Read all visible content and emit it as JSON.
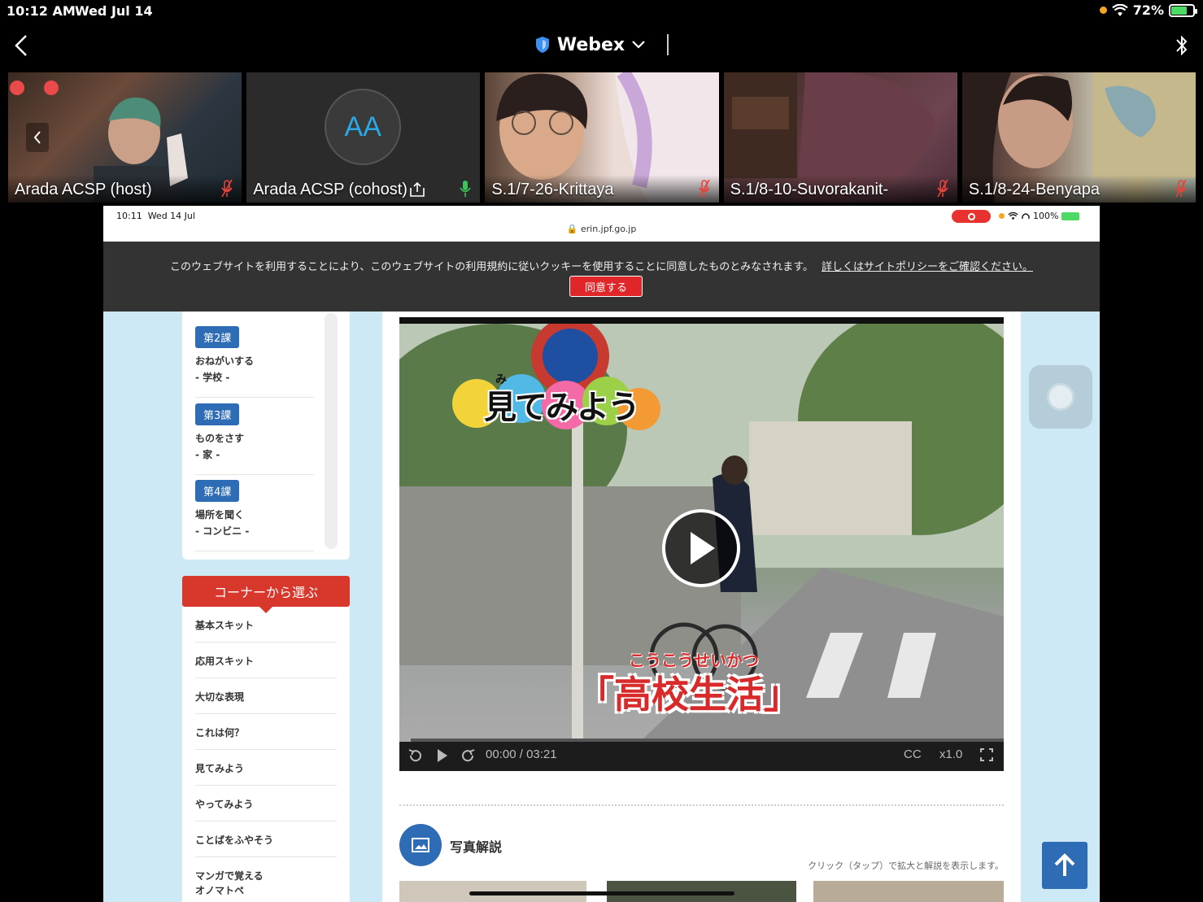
{
  "status_bar": {
    "time": "10:12 AM",
    "date": "Wed Jul 14",
    "battery": "72%",
    "battery_level": 0.72
  },
  "header": {
    "title": "Webex"
  },
  "participants": [
    {
      "name": "Arada ACSP (host)",
      "mic": "muted"
    },
    {
      "name": "Arada ACSP (cohost)",
      "initials": "AA",
      "mic": "active"
    },
    {
      "name": "S.1/7-26-Krittaya",
      "mic": "muted"
    },
    {
      "name": "S.1/8-10-Suvorakanit-",
      "mic": "muted"
    },
    {
      "name": "S.1/8-24-Benyapa",
      "mic": "muted"
    }
  ],
  "shared_screen": {
    "status": {
      "time": "10:11",
      "date": "Wed 14 Jul",
      "battery": "100%",
      "url": "erin.jpf.go.jp"
    },
    "cookie": {
      "message": "このウェブサイトを利用することにより、このウェブサイトの利用規約に従いクッキーを使用することに同意したものとみなされます。",
      "link": "詳しくはサイトポリシーをご確認ください。",
      "button": "同意する"
    },
    "lessons": [
      {
        "badge": "第2課",
        "line1": "おねがいする",
        "line2": "- 学校 -"
      },
      {
        "badge": "第3課",
        "line1": "ものをさす",
        "line2": "- 家 -"
      },
      {
        "badge": "第4課",
        "line1": "場所を聞く",
        "line2": "- コンビニ -"
      }
    ],
    "corner": {
      "heading": "コーナーから選ぶ",
      "items": [
        "基本スキット",
        "応用スキット",
        "大切な表現",
        "これは何？",
        "見てみよう",
        "やってみよう",
        "ことばをふやそう",
        "マンガで覚える",
        "オノマトペ"
      ]
    },
    "video": {
      "overlay_title": "見てみよう",
      "overlay_ruby": "み",
      "caption_ruby": "こうこうせいかつ",
      "caption": "「高校生活」",
      "current_time": "00:00",
      "duration": "03:21",
      "cc": "CC",
      "speed": "x1.0"
    },
    "photo_section": {
      "title": "写真解説",
      "note": "クリック（タップ）で拡大と解説を表示します。"
    }
  }
}
